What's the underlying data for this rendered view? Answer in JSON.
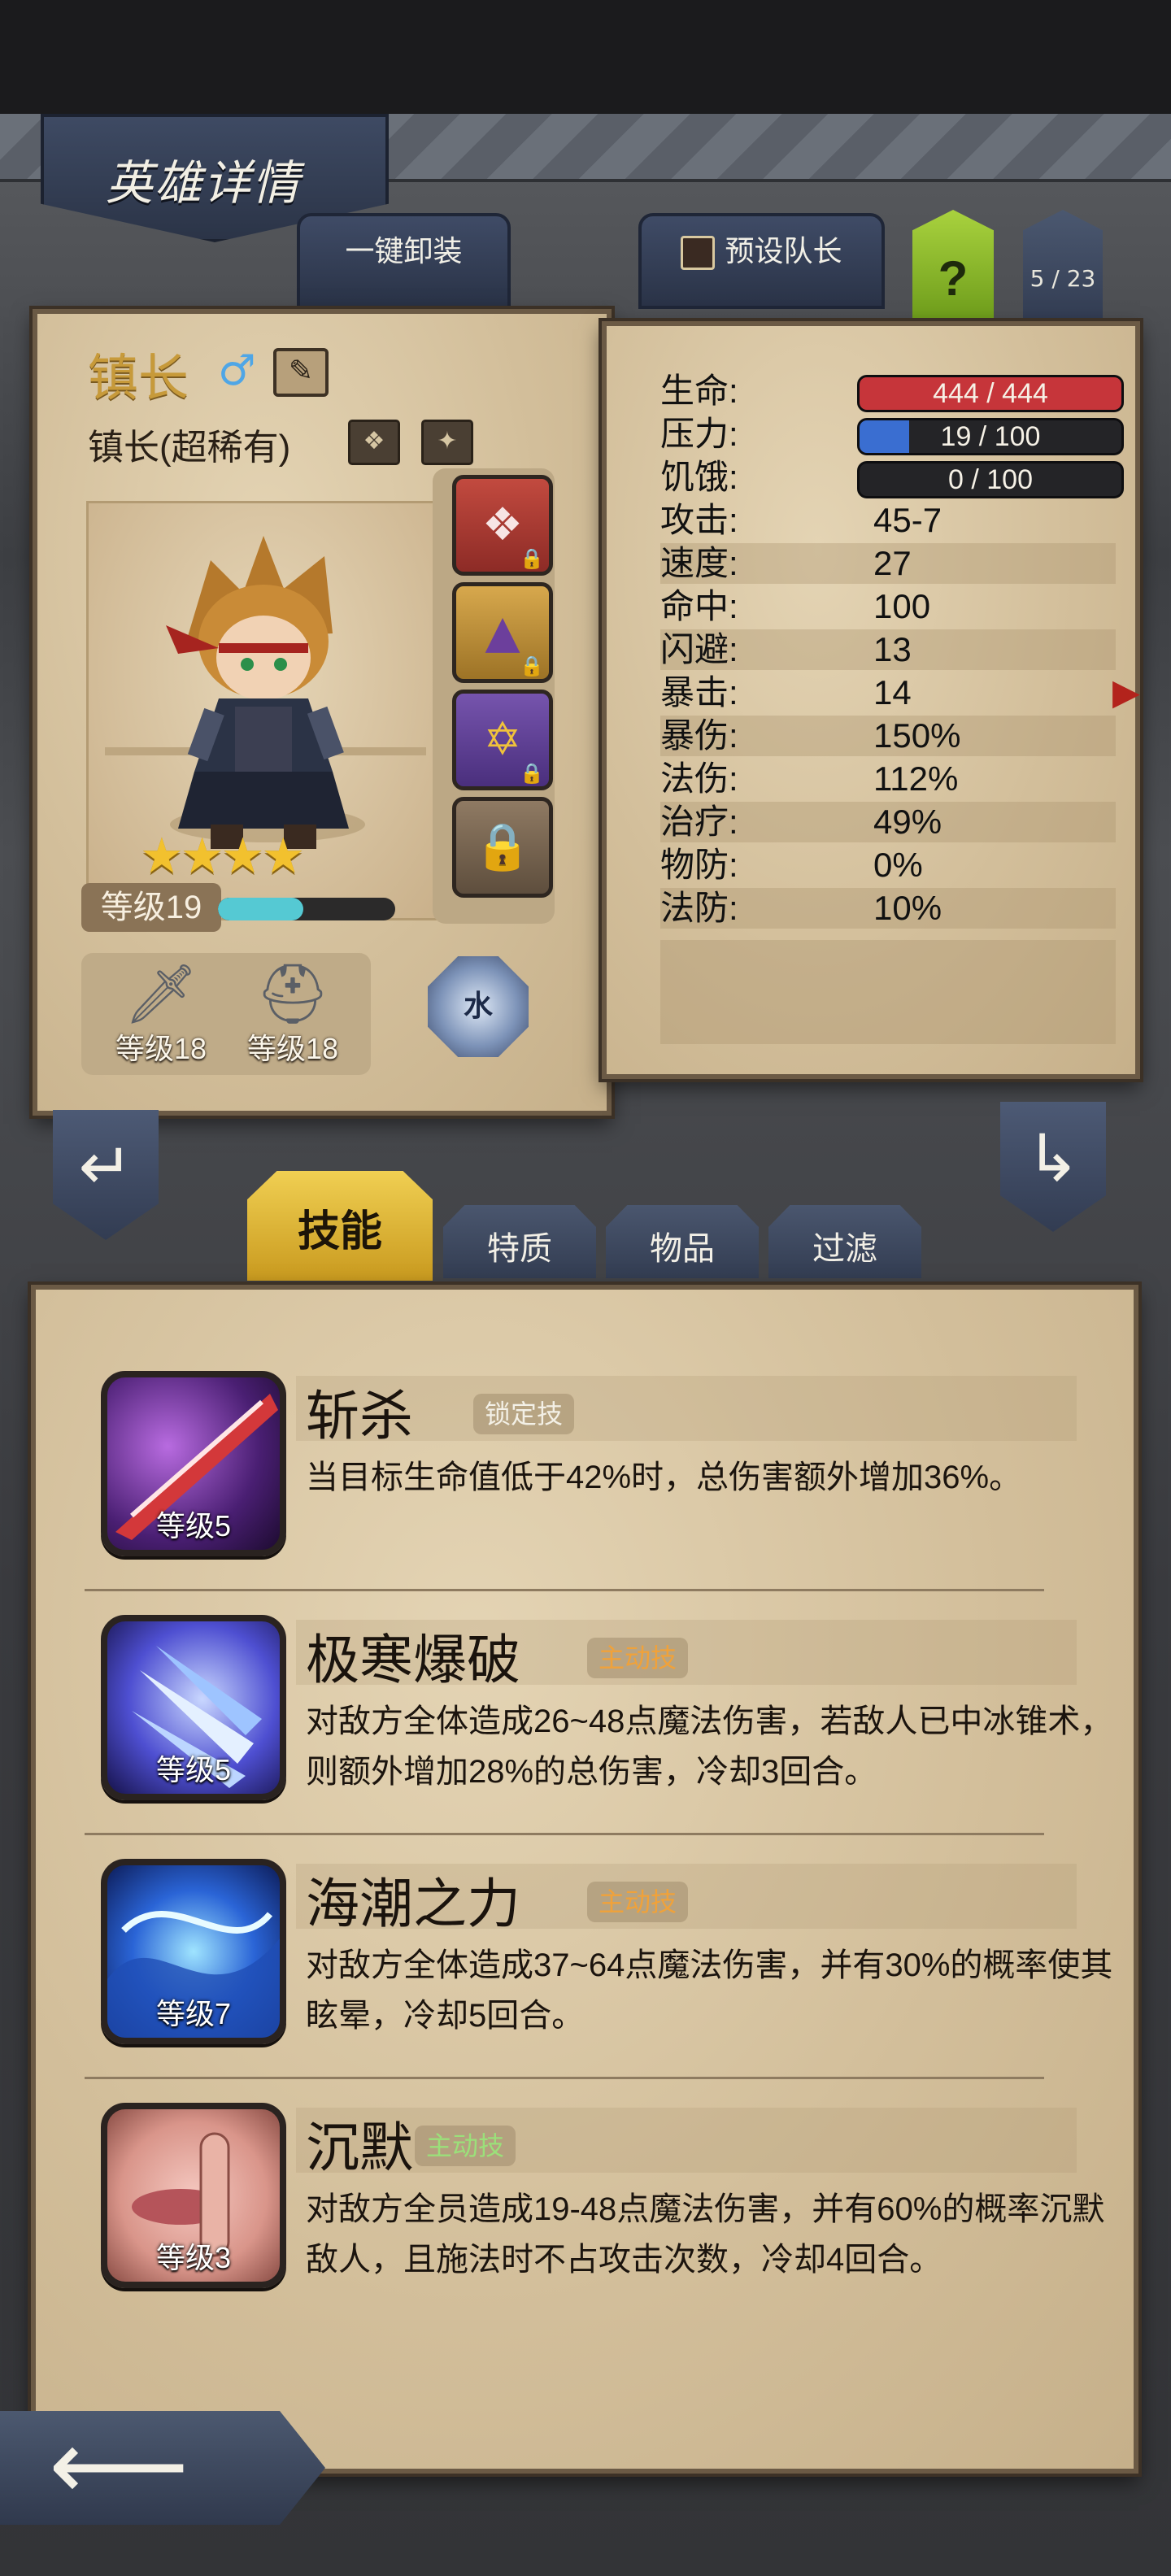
{
  "header": {
    "title": "英雄详情",
    "unload_all": "一键卸装",
    "preset_leader": "预设队长",
    "help": "?",
    "hero_count": "5 / 23"
  },
  "hero": {
    "name": "镇长",
    "gender_icon": "male-icon",
    "class_label": "镇长(超稀有)",
    "stars": 4,
    "level_label": "等级19",
    "exp_fraction": 0.48,
    "element": "水",
    "gear": [
      {
        "icon": "sword-icon",
        "level": "等级18"
      },
      {
        "icon": "helmet-icon",
        "level": "等级18"
      }
    ],
    "equip_slots": [
      {
        "icon": "amulet-icon",
        "locked": true
      },
      {
        "icon": "wizard-hat-icon",
        "locked": true
      },
      {
        "icon": "pentagram-icon",
        "locked": true
      },
      {
        "icon": "padlock-icon",
        "locked": true
      }
    ]
  },
  "stats": {
    "hp": {
      "label": "生命:",
      "value": "444 / 444",
      "fraction": 1.0,
      "color": "#c6353a"
    },
    "stress": {
      "label": "压力:",
      "value": "19 / 100",
      "fraction": 0.19,
      "color": "#3a6ed1"
    },
    "hunger": {
      "label": "饥饿:",
      "value": "0 / 100",
      "fraction": 0.0,
      "color": "#5a5a5a"
    },
    "rows": [
      {
        "label": "攻击:",
        "value": "45-7"
      },
      {
        "label": "速度:",
        "value": "27"
      },
      {
        "label": "命中:",
        "value": "100"
      },
      {
        "label": "闪避:",
        "value": "13"
      },
      {
        "label": "暴击:",
        "value": "14"
      },
      {
        "label": "暴伤:",
        "value": "150%"
      },
      {
        "label": "法伤:",
        "value": "112%"
      },
      {
        "label": "治疗:",
        "value": "49%"
      },
      {
        "label": "物防:",
        "value": "0%"
      },
      {
        "label": "法防:",
        "value": "10%"
      }
    ]
  },
  "tabs": [
    {
      "label": "技能",
      "active": true
    },
    {
      "label": "特质",
      "active": false
    },
    {
      "label": "物品",
      "active": false
    },
    {
      "label": "过滤",
      "active": false
    }
  ],
  "skills": [
    {
      "name": "斩杀",
      "tag": "锁定技",
      "tag_color": "#f3f0e6",
      "level": "等级5",
      "desc": "当目标生命值低于42%时，总伤害额外增加36%。",
      "icon": "slash-icon"
    },
    {
      "name": "极寒爆破",
      "tag": "主动技",
      "tag_color": "#f0a23a",
      "level": "等级5",
      "desc": "对敌方全体造成26~48点魔法伤害，若敌人已中冰锥术，则额外增加28%的总伤害，冷却3回合。",
      "icon": "ice-shard-icon"
    },
    {
      "name": "海潮之力",
      "tag": "主动技",
      "tag_color": "#f0a23a",
      "level": "等级7",
      "desc": "对敌方全体造成37~64点魔法伤害，并有30%的概率使其眩晕，冷却5回合。",
      "icon": "wave-icon"
    },
    {
      "name": "沉默",
      "tag": "主动技",
      "tag_color": "#9be07a",
      "level": "等级3",
      "desc": "对敌方全员造成19-48点魔法伤害，并有60%的概率沉默敌人，且施法时不占攻击次数，冷却4回合。",
      "icon": "silence-icon"
    }
  ]
}
